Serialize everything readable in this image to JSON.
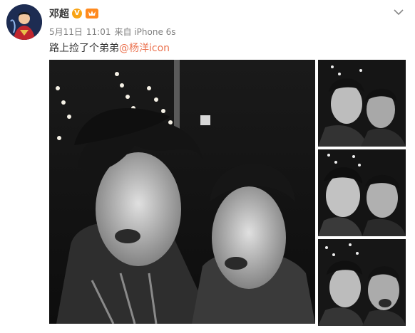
{
  "post": {
    "username": "邓超",
    "verified_badge": "V",
    "date": "5月11日",
    "time": "11:01",
    "source": "来自 iPhone 6s",
    "text_before_mention": "路上捡了个弟弟",
    "mention": "@杨洋icon"
  },
  "icons": {
    "avatar": "avatar-icon",
    "verified": "verified-v-icon",
    "level": "member-level-icon",
    "menu": "chevron-down-icon"
  },
  "colors": {
    "username": "#333333",
    "meta": "#808080",
    "mention": "#eb7350",
    "verified_badge": "#f8a415",
    "level_badge": "#ff8a1f"
  },
  "photos": {
    "count": 4,
    "description_style": "black-and-white night selfies"
  }
}
